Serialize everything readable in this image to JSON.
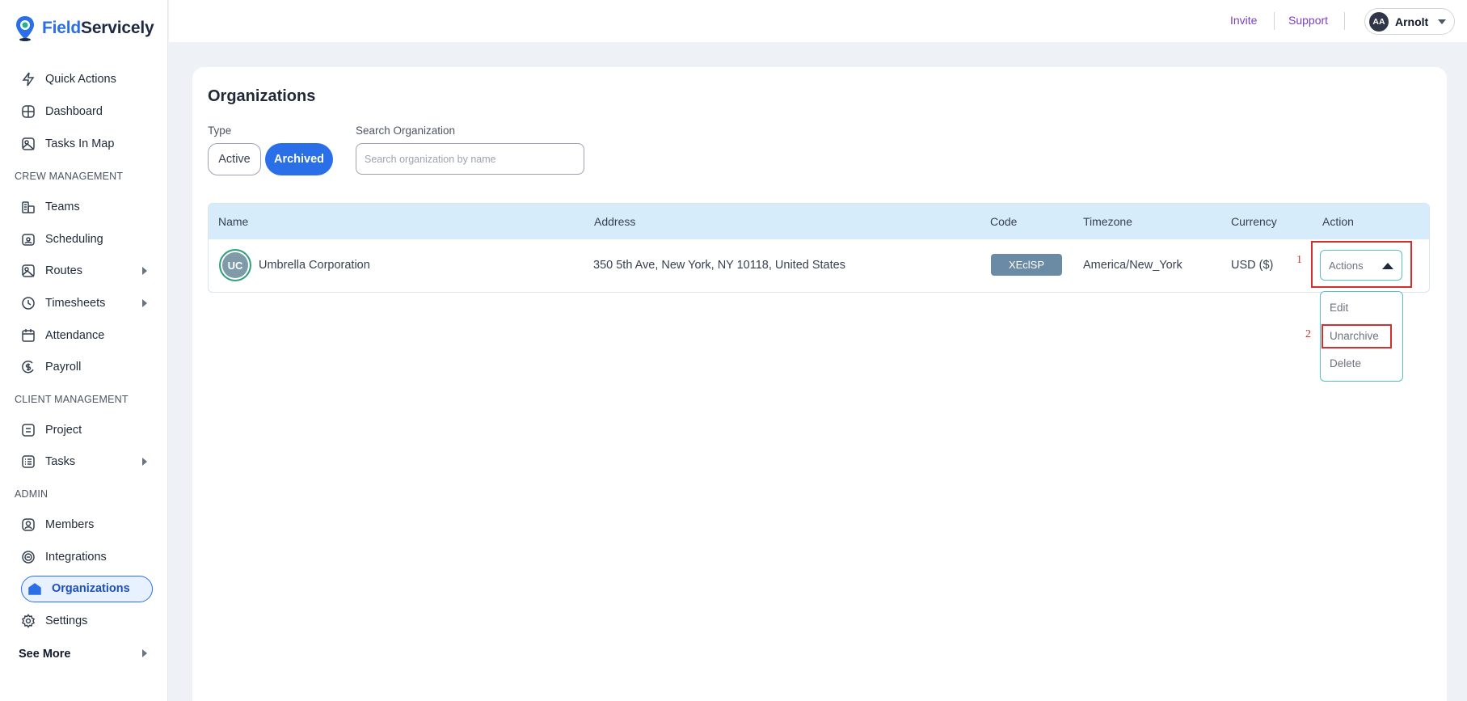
{
  "brand": {
    "part1": "Field",
    "part2": "Servicely"
  },
  "sidebar": {
    "items": [
      {
        "label": "Quick Actions",
        "icon": "bolt-icon"
      },
      {
        "label": "Dashboard",
        "icon": "dashboard-icon"
      },
      {
        "label": "Tasks In Map",
        "icon": "map-icon"
      },
      {
        "label": "Teams",
        "icon": "teams-icon"
      },
      {
        "label": "Scheduling",
        "icon": "calendar-icon"
      },
      {
        "label": "Routes",
        "icon": "routes-icon"
      },
      {
        "label": "Timesheets",
        "icon": "clock-icon"
      },
      {
        "label": "Attendance",
        "icon": "attendance-icon"
      },
      {
        "label": "Payroll",
        "icon": "dollar-icon"
      },
      {
        "label": "Project",
        "icon": "project-icon"
      },
      {
        "label": "Tasks",
        "icon": "tasks-icon"
      },
      {
        "label": "Members",
        "icon": "user-icon"
      },
      {
        "label": "Integrations",
        "icon": "integrations-icon"
      },
      {
        "label": "Organizations",
        "icon": "building-icon"
      },
      {
        "label": "Settings",
        "icon": "gear-icon"
      }
    ],
    "sections": {
      "crew": "CREW MANAGEMENT",
      "client": "CLIENT MANAGEMENT",
      "admin": "ADMIN"
    },
    "see_more": "See More"
  },
  "header": {
    "invite": "Invite",
    "support": "Support",
    "user_initials": "AA",
    "user_name": "Arnolt"
  },
  "page": {
    "title": "Organizations",
    "type_label": "Type",
    "type_active": "Active",
    "type_archived": "Archived",
    "search_label": "Search Organization",
    "search_placeholder": "Search organization by name"
  },
  "table": {
    "columns": [
      "Name",
      "Address",
      "Code",
      "Timezone",
      "Currency",
      "Action"
    ],
    "rows": [
      {
        "initials": "UC",
        "name": "Umbrella Corporation",
        "address": "350 5th Ave, New York, NY 10118, United States",
        "code": "XEclSP",
        "timezone": "America/New_York",
        "currency": "USD ($)",
        "action": "Actions"
      }
    ]
  },
  "dropdown": {
    "items": [
      "Edit",
      "Unarchive",
      "Delete"
    ]
  },
  "annotations": {
    "step1": "1",
    "step2": "2"
  },
  "colors": {
    "accent": "#2b6fe8",
    "link": "#7b3fbf",
    "highlight": "#d32f2f",
    "header_row": "#d6ecfb"
  }
}
